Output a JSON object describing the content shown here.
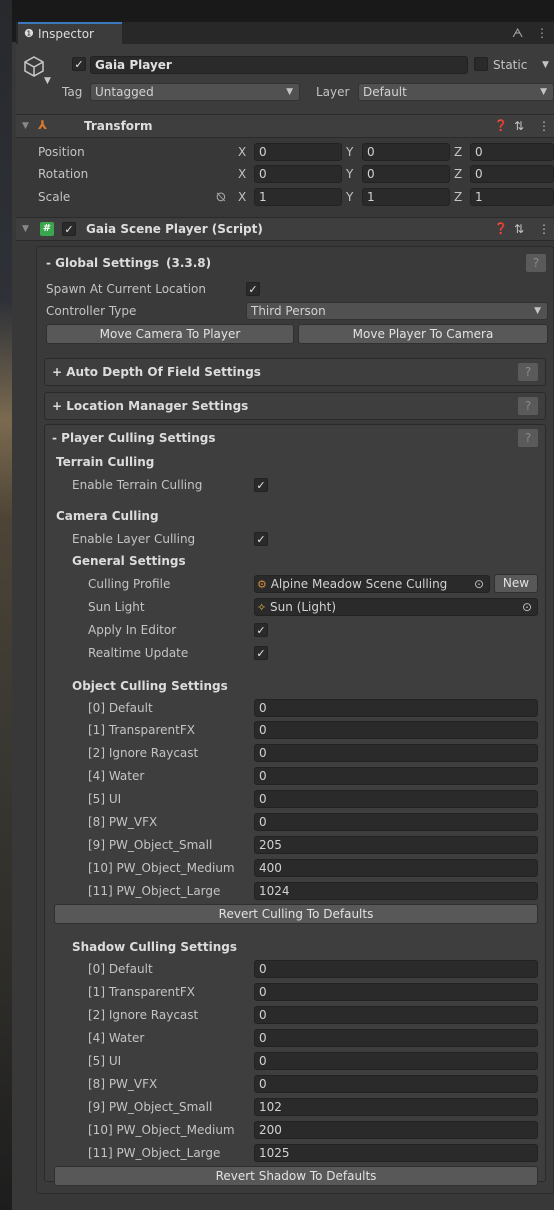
{
  "tab": {
    "title": "Inspector"
  },
  "object": {
    "name": "Gaia Player",
    "static_label": "Static",
    "tag_label": "Tag",
    "tag_value": "Untagged",
    "layer_label": "Layer",
    "layer_value": "Default"
  },
  "transform": {
    "title": "Transform",
    "position_label": "Position",
    "rotation_label": "Rotation",
    "scale_label": "Scale",
    "axis_x": "X",
    "axis_y": "Y",
    "axis_z": "Z",
    "position": [
      "0",
      "0",
      "0"
    ],
    "rotation": [
      "0",
      "0",
      "0"
    ],
    "scale": [
      "1",
      "1",
      "1"
    ]
  },
  "script": {
    "title": "Gaia Scene Player (Script)"
  },
  "global": {
    "header": "- Global Settings",
    "version": "(3.3.8)",
    "spawn_label": "Spawn At Current Location",
    "controller_label": "Controller Type",
    "controller_value": "Third Person",
    "move_camera_btn": "Move Camera To Player",
    "move_player_btn": "Move Player To Camera"
  },
  "sections": {
    "dof": "+ Auto Depth Of Field Settings",
    "location": "+ Location Manager Settings",
    "culling": "- Player Culling Settings"
  },
  "culling": {
    "terrain_header": "Terrain Culling",
    "enable_terrain": "Enable Terrain Culling",
    "camera_header": "Camera Culling",
    "enable_layer": "Enable Layer Culling",
    "general_header": "General Settings",
    "profile_label": "Culling Profile",
    "profile_value": "Alpine Meadow Scene Culling",
    "new_btn": "New",
    "sun_label": "Sun Light",
    "sun_value": "Sun (Light)",
    "apply_label": "Apply In Editor",
    "realtime_label": "Realtime Update",
    "object_header": "Object Culling Settings",
    "object_rows": [
      {
        "label": "[0] Default",
        "value": "0"
      },
      {
        "label": "[1] TransparentFX",
        "value": "0"
      },
      {
        "label": "[2] Ignore Raycast",
        "value": "0"
      },
      {
        "label": "[4] Water",
        "value": "0"
      },
      {
        "label": "[5] UI",
        "value": "0"
      },
      {
        "label": "[8] PW_VFX",
        "value": "0"
      },
      {
        "label": "[9] PW_Object_Small",
        "value": "205"
      },
      {
        "label": "[10] PW_Object_Medium",
        "value": "400"
      },
      {
        "label": "[11] PW_Object_Large",
        "value": "1024"
      }
    ],
    "revert_culling_btn": "Revert Culling To Defaults",
    "shadow_header": "Shadow Culling Settings",
    "shadow_rows": [
      {
        "label": "[0] Default",
        "value": "0"
      },
      {
        "label": "[1] TransparentFX",
        "value": "0"
      },
      {
        "label": "[2] Ignore Raycast",
        "value": "0"
      },
      {
        "label": "[4] Water",
        "value": "0"
      },
      {
        "label": "[5] UI",
        "value": "0"
      },
      {
        "label": "[8] PW_VFX",
        "value": "0"
      },
      {
        "label": "[9] PW_Object_Small",
        "value": "102"
      },
      {
        "label": "[10] PW_Object_Medium",
        "value": "200"
      },
      {
        "label": "[11] PW_Object_Large",
        "value": "1025"
      }
    ],
    "revert_shadow_btn": "Revert Shadow To Defaults"
  }
}
